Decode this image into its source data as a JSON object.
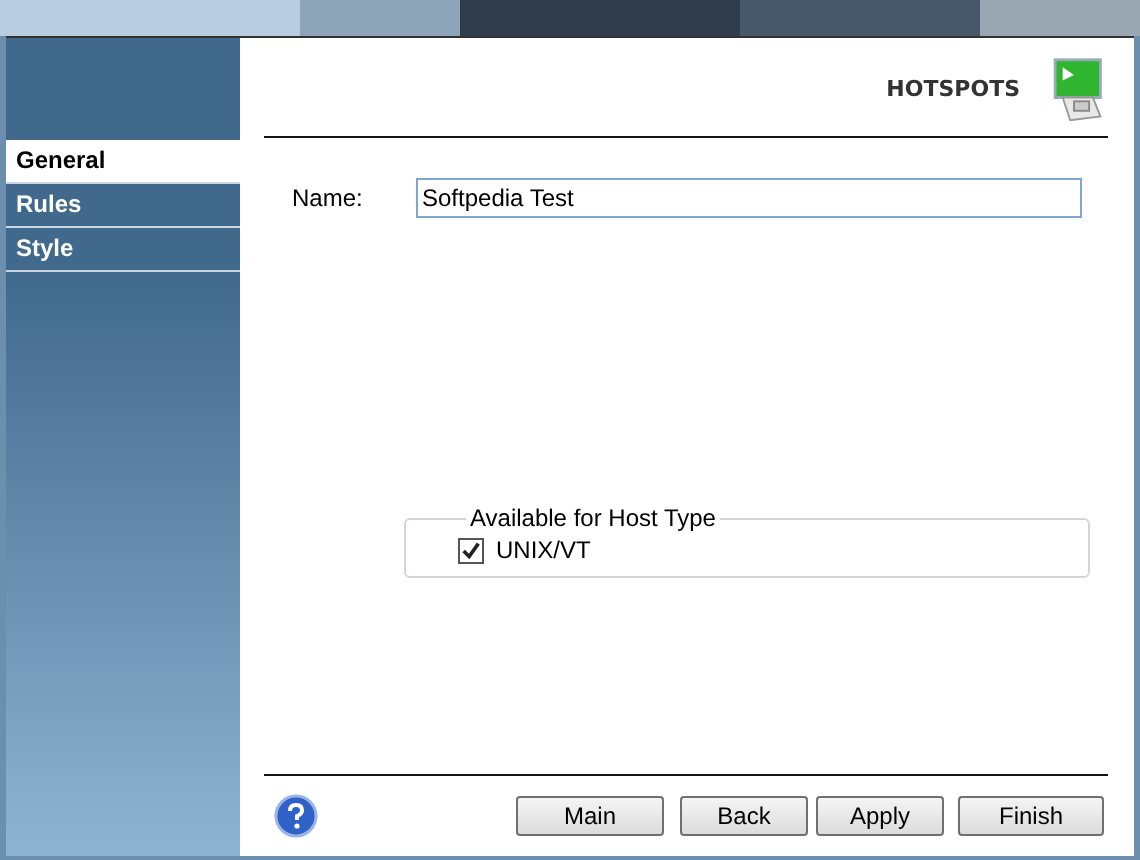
{
  "sidebar": {
    "items": [
      {
        "label": "General",
        "selected": true
      },
      {
        "label": "Rules",
        "selected": false
      },
      {
        "label": "Style",
        "selected": false
      }
    ]
  },
  "header": {
    "title": "HOTSPOTS"
  },
  "name_field": {
    "label": "Name:",
    "value": "Softpedia Test"
  },
  "host_type": {
    "title": "Available for Host Type",
    "options": [
      {
        "label": "UNIX/VT",
        "checked": true
      }
    ]
  },
  "buttons": [
    "Main",
    "Back",
    "Apply",
    "Finish"
  ]
}
